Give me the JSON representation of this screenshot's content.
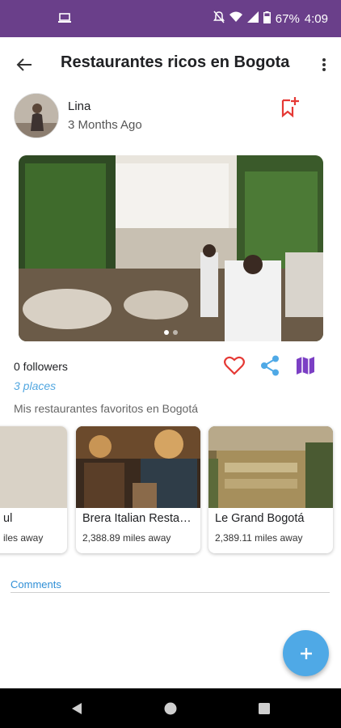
{
  "status_bar": {
    "battery": "67%",
    "time": "4:09"
  },
  "header": {
    "title": "Restaurantes ricos en Bogota"
  },
  "author": {
    "name": "Lina",
    "posted": "3 Months Ago"
  },
  "stats": {
    "followers": "0 followers",
    "places": "3 places"
  },
  "description": "Mis restaurantes favoritos en Bogotá",
  "places": [
    {
      "title": "ul",
      "distance": "iles away"
    },
    {
      "title": "Brera Italian Resta…",
      "distance": "2,388.89 miles away"
    },
    {
      "title": "Le Grand Bogotá",
      "distance": "2,389.11 miles away"
    }
  ],
  "comments": {
    "label": "Comments"
  },
  "colors": {
    "status_bar": "#6a3f8a",
    "accent_red": "#e53935",
    "accent_blue": "#4fa9e6",
    "map_purple": "#7b3fc4"
  },
  "icons": {
    "back": "arrow-back-icon",
    "more": "more-vert-icon",
    "save": "bookmark-add-icon",
    "like": "heart-icon",
    "share": "share-icon",
    "map": "map-icon",
    "fab": "plus-icon"
  }
}
